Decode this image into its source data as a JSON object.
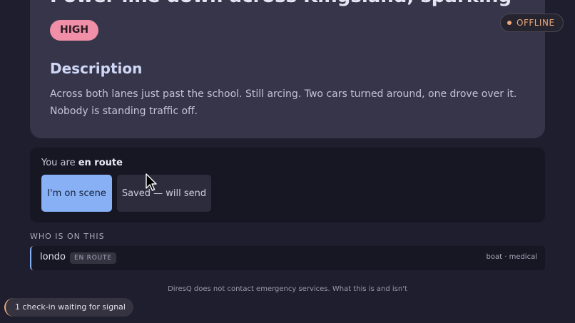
{
  "incident": {
    "title": "Power line down across Kingsland, sparking",
    "severity": "HIGH",
    "description_heading": "Description",
    "description": "Across both lanes just past the school. Still arcing. Two cars turned around, one drove over it. Nobody is standing traffic off."
  },
  "connection": {
    "label": "OFFLINE"
  },
  "status": {
    "prefix": "You are ",
    "current": "en route",
    "primary_action": "I'm on scene",
    "secondary_action": "Saved — will send"
  },
  "responders": {
    "heading": "WHO IS ON THIS",
    "items": [
      {
        "name": "londo",
        "status": "EN ROUTE",
        "skills": "boat · medical"
      }
    ]
  },
  "footer": {
    "note": "DiresQ does not contact emergency services. What this is and isn't"
  },
  "queue": {
    "label": "1 check-in waiting for signal"
  },
  "colors": {
    "accent_blue": "#88b0f5",
    "severity_pink": "#f08fa7",
    "offline_orange": "#f0a877"
  }
}
